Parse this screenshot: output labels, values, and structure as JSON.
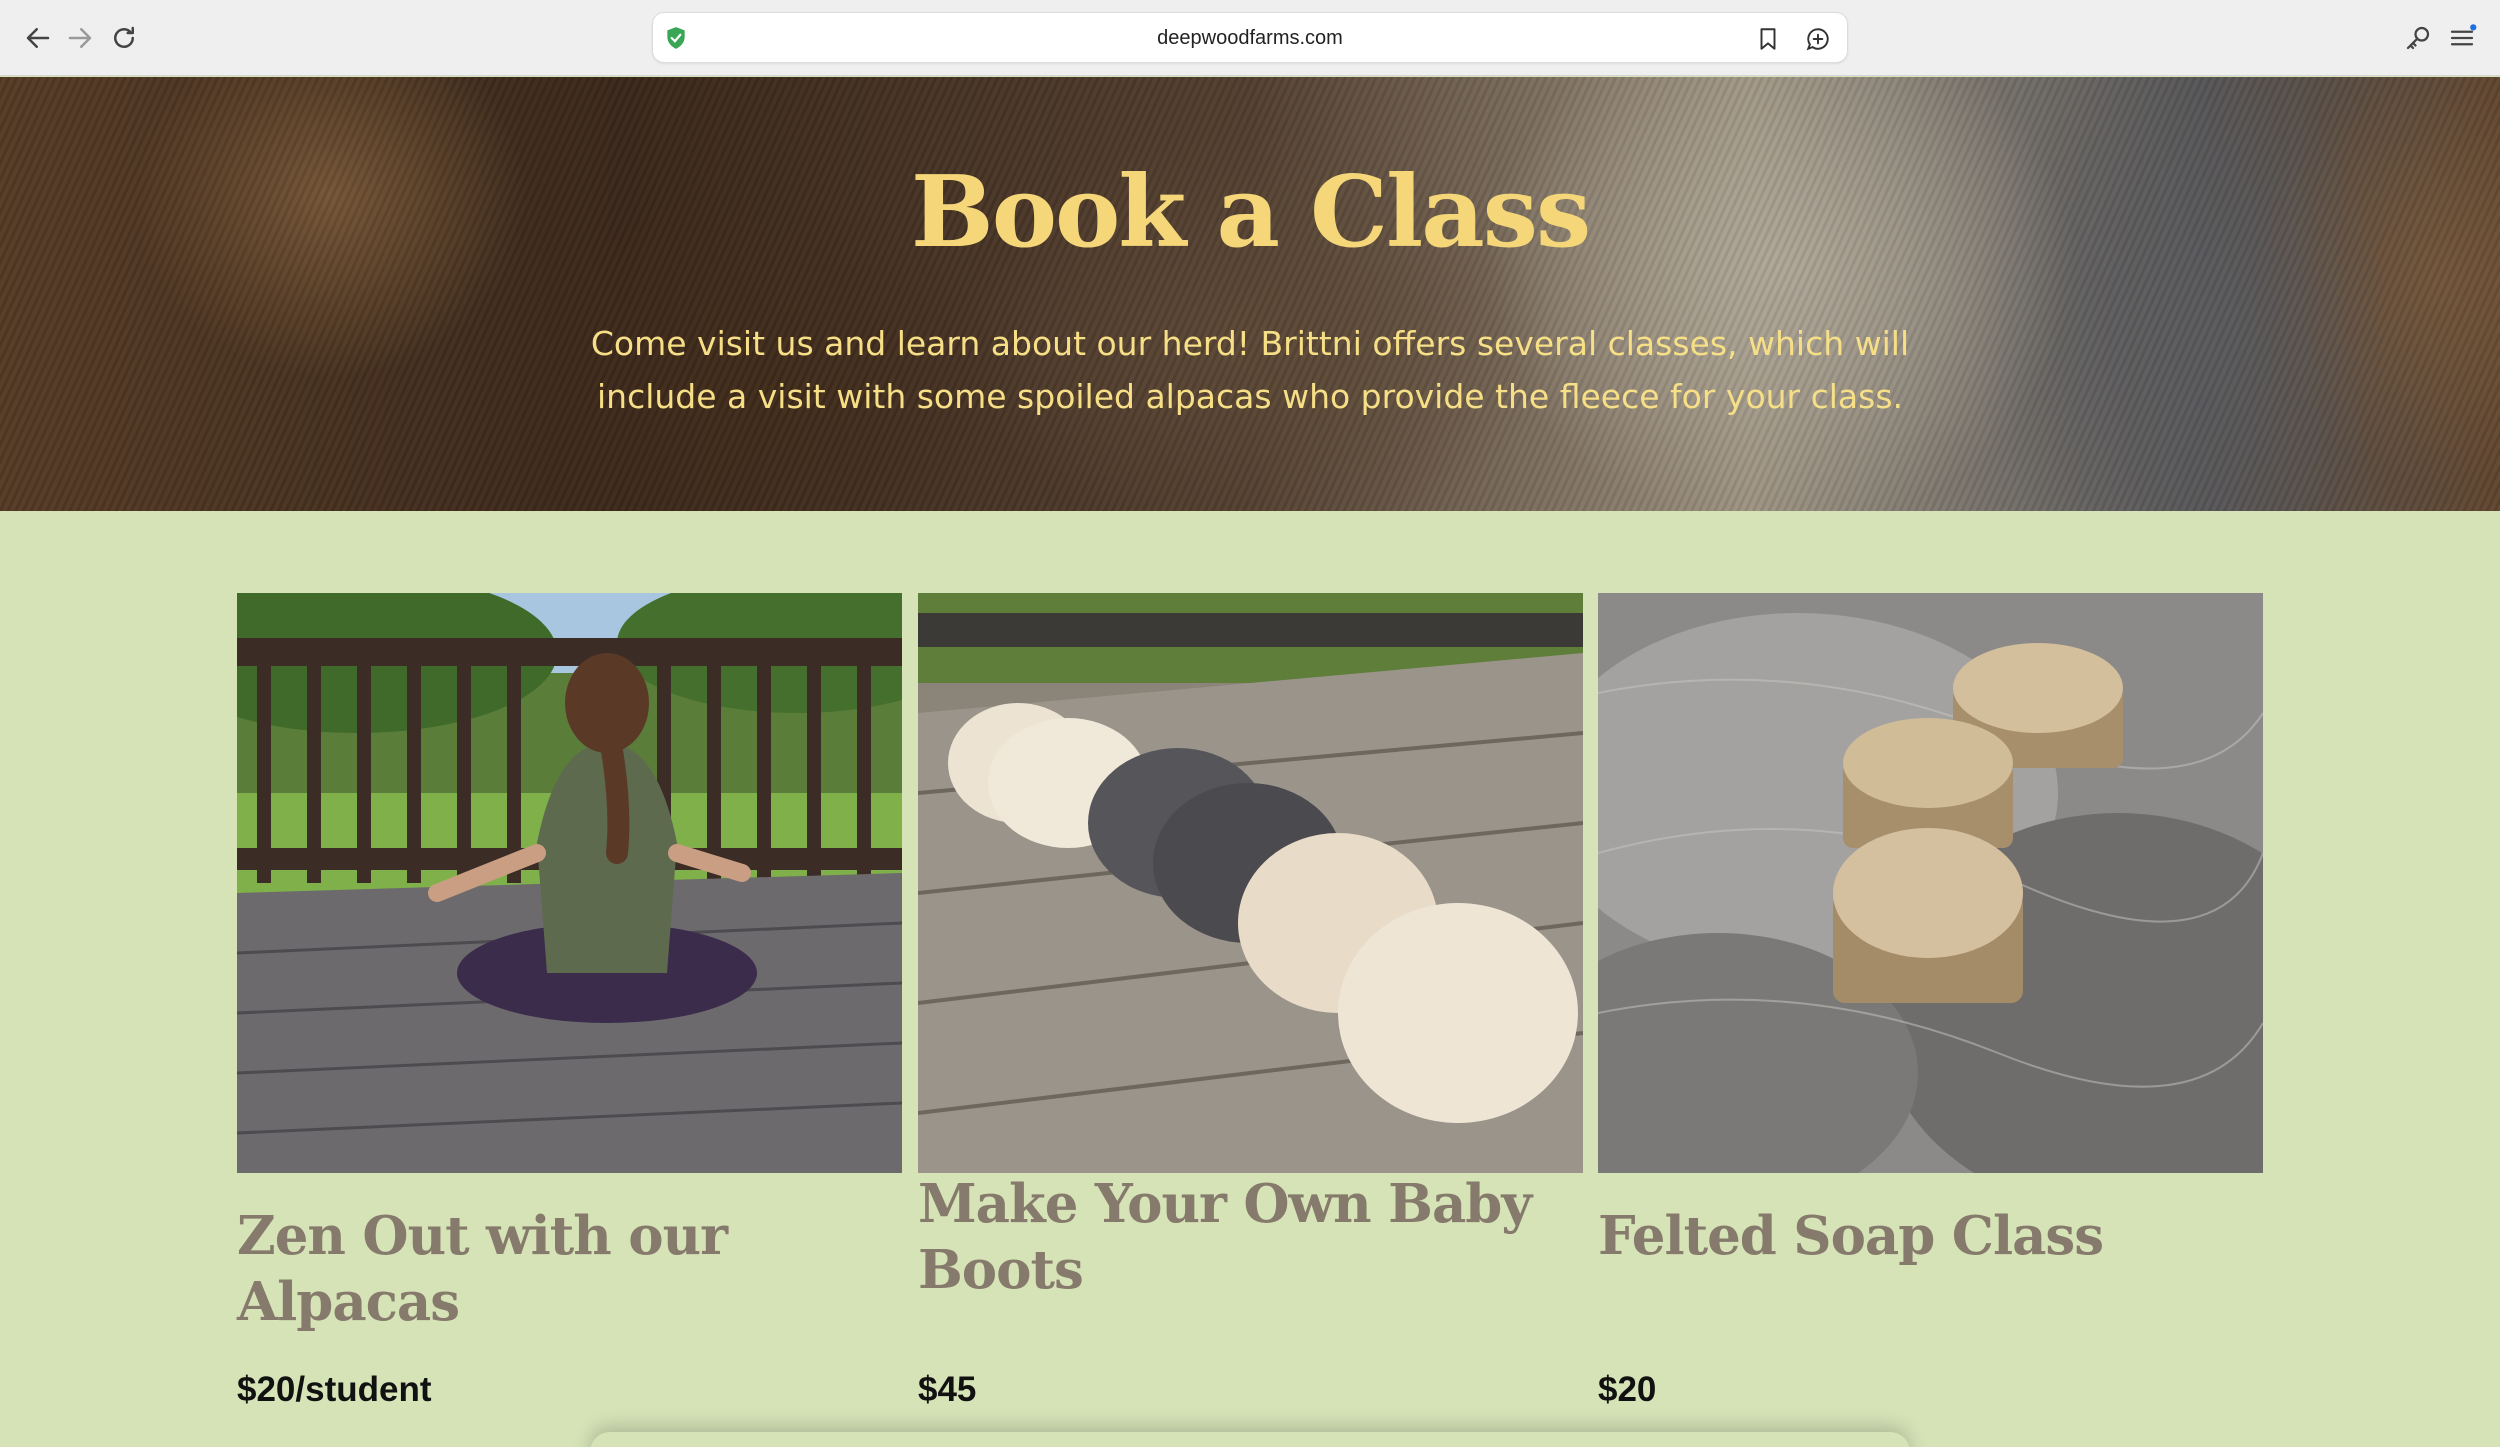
{
  "browser": {
    "url": "deepwoodfarms.com",
    "icons": [
      "back-arrow-icon",
      "forward-arrow-icon",
      "reload-icon",
      "shield-icon",
      "bookmark-icon",
      "chat-add-icon",
      "key-icon",
      "menu-icon"
    ]
  },
  "hero": {
    "title": "Book a Class",
    "text": "Come visit us and learn about our herd! Brittni offers several classes, which will include a visit with some spoiled alpacas who provide the fleece for your class."
  },
  "classes": [
    {
      "title": "Zen Out with our Alpacas",
      "price": "$20/student"
    },
    {
      "title": "Make Your Own Baby Boots",
      "price": "$45"
    },
    {
      "title": "Felted Soap Class",
      "price": "$20"
    }
  ],
  "colors": {
    "hero_title": "#f5d77a",
    "page_background": "#d6e3b7",
    "card_title": "#857a6b"
  }
}
